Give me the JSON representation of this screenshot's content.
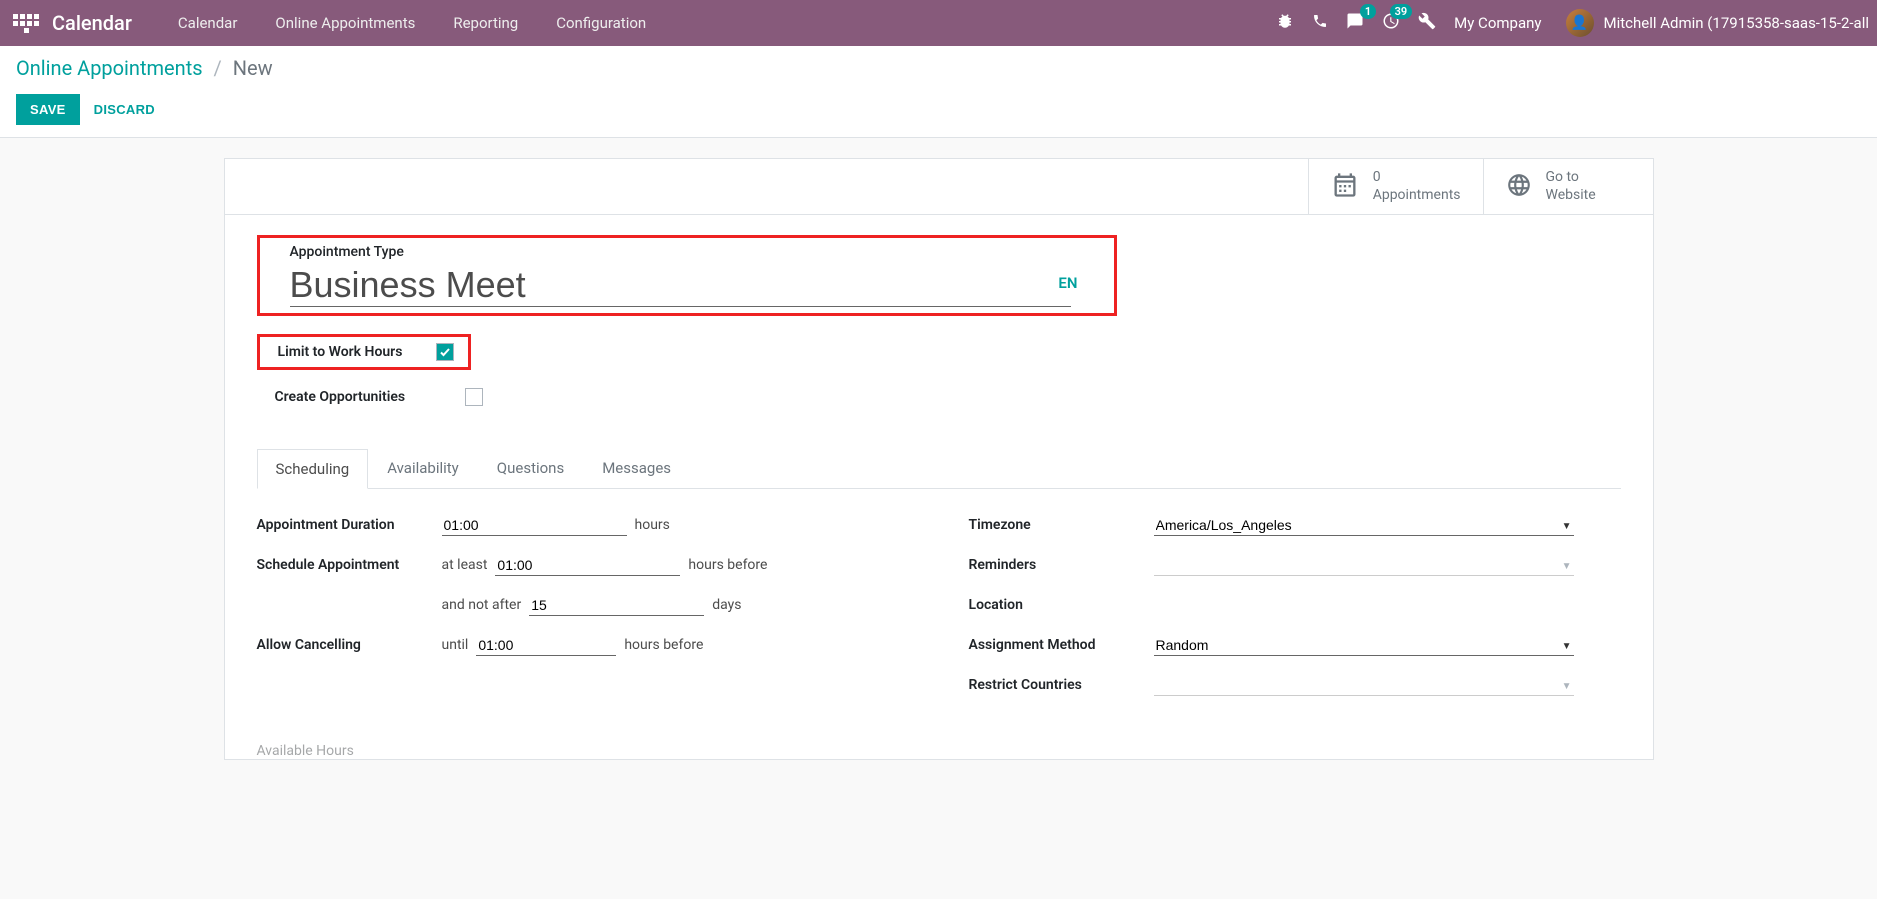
{
  "header": {
    "brand": "Calendar",
    "nav": [
      "Calendar",
      "Online Appointments",
      "Reporting",
      "Configuration"
    ],
    "badges": {
      "messages": "1",
      "activities": "39"
    },
    "company": "My Company",
    "user": "Mitchell Admin (17915358-saas-15-2-all"
  },
  "breadcrumb": {
    "parent": "Online Appointments",
    "current": "New"
  },
  "actions": {
    "save": "SAVE",
    "discard": "DISCARD"
  },
  "stat_buttons": {
    "appointments": {
      "count": "0",
      "label": "Appointments"
    },
    "website": {
      "line1": "Go to",
      "line2": "Website"
    }
  },
  "title": {
    "label": "Appointment Type",
    "value": "Business Meet",
    "lang": "EN"
  },
  "checkboxes": {
    "limit_label": "Limit to Work Hours",
    "limit_checked": true,
    "opp_label": "Create Opportunities",
    "opp_checked": false
  },
  "tabs": [
    "Scheduling",
    "Availability",
    "Questions",
    "Messages"
  ],
  "scheduling": {
    "duration_label": "Appointment Duration",
    "duration_value": "01:00",
    "duration_unit": "hours",
    "schedule_label": "Schedule Appointment",
    "at_least_prefix": "at least",
    "at_least_value": "01:00",
    "at_least_suffix": "hours before",
    "not_after_prefix": "and not after",
    "not_after_value": "15",
    "not_after_suffix": "days",
    "cancel_label": "Allow Cancelling",
    "cancel_prefix": "until",
    "cancel_value": "01:00",
    "cancel_suffix": "hours before",
    "timezone_label": "Timezone",
    "timezone_value": "America/Los_Angeles",
    "reminders_label": "Reminders",
    "reminders_value": "",
    "location_label": "Location",
    "assignment_label": "Assignment Method",
    "assignment_value": "Random",
    "restrict_label": "Restrict Countries",
    "restrict_value": ""
  },
  "footer_label": "Available Hours"
}
